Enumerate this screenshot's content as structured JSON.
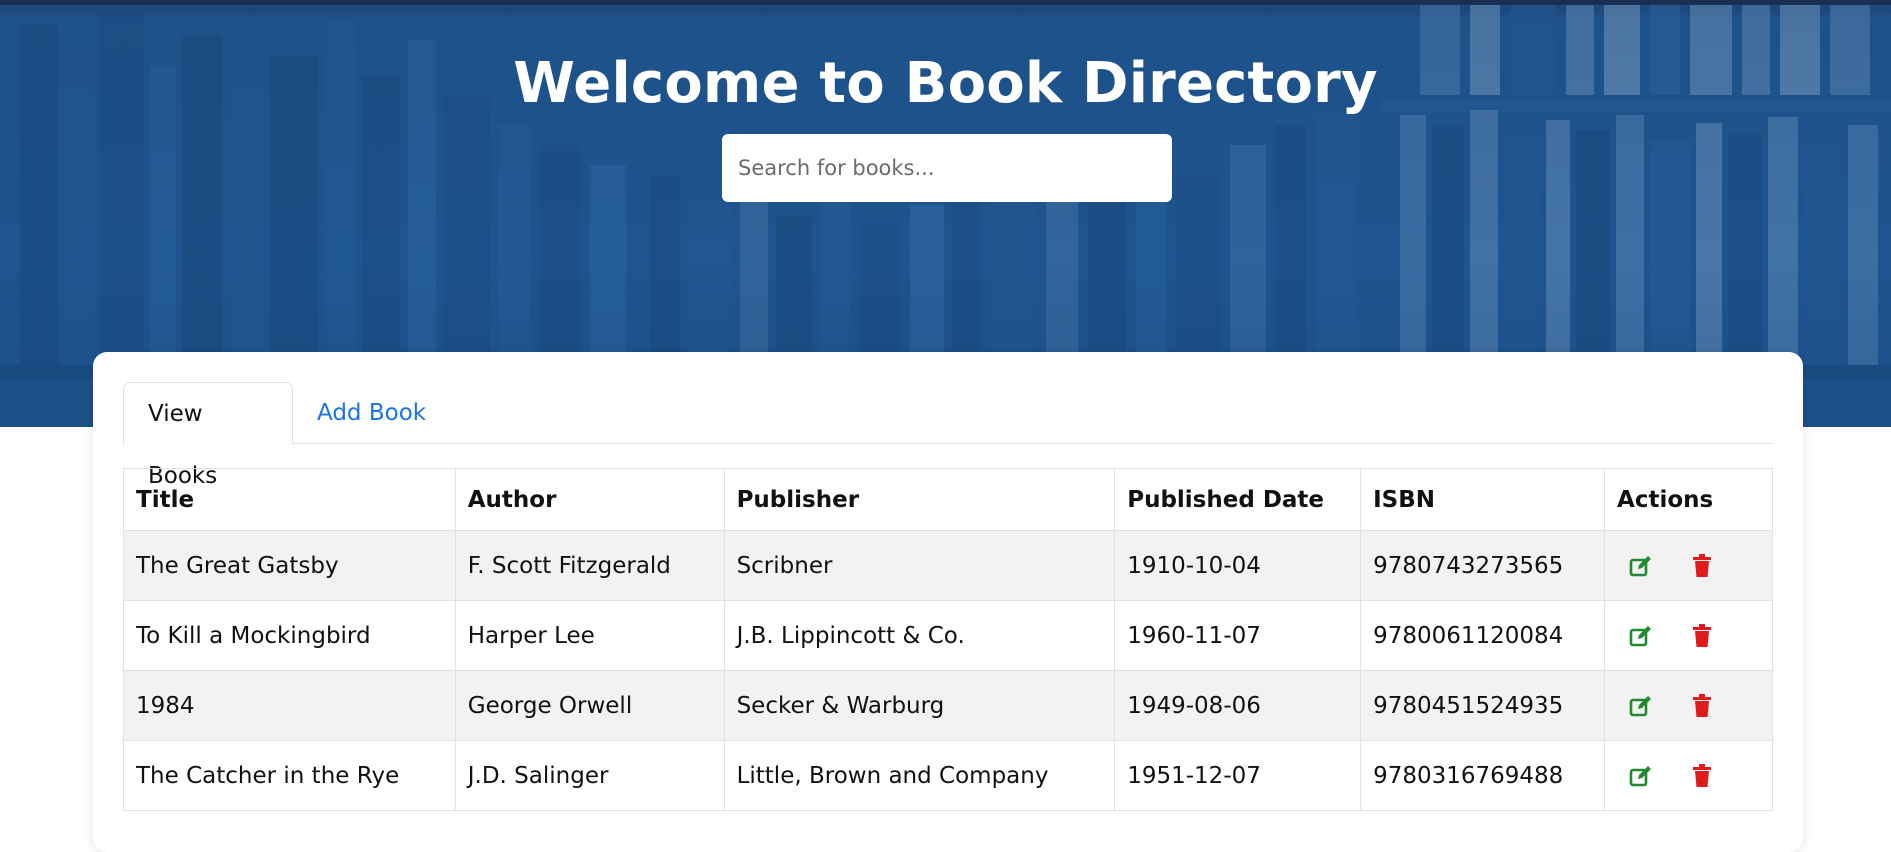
{
  "hero": {
    "title": "Welcome to Book Directory"
  },
  "search": {
    "placeholder": "Search for books..."
  },
  "tabs": [
    {
      "label": "View Books",
      "active": true
    },
    {
      "label": "Add Book",
      "active": false
    }
  ],
  "table": {
    "headers": [
      "Title",
      "Author",
      "Publisher",
      "Published Date",
      "ISBN",
      "Actions"
    ],
    "rows": [
      {
        "title": "The Great Gatsby",
        "author": "F. Scott Fitzgerald",
        "publisher": "Scribner",
        "published_date": "1910-10-04",
        "isbn": "9780743273565"
      },
      {
        "title": "To Kill a Mockingbird",
        "author": "Harper Lee",
        "publisher": "J.B. Lippincott & Co.",
        "published_date": "1960-11-07",
        "isbn": "9780061120084"
      },
      {
        "title": "1984",
        "author": "George Orwell",
        "publisher": "Secker & Warburg",
        "published_date": "1949-08-06",
        "isbn": "9780451524935"
      },
      {
        "title": "The Catcher in the Rye",
        "author": "J.D. Salinger",
        "publisher": "Little, Brown and Company",
        "published_date": "1951-12-07",
        "isbn": "9780316769488"
      }
    ]
  },
  "icons": {
    "edit": "edit-icon",
    "delete": "trash-icon"
  },
  "colors": {
    "hero_blue": "#1f5289",
    "link_blue": "#1a73e8",
    "edit_green": "#1f8a2e",
    "delete_red": "#e01b1b",
    "row_stripe": "#f2f2f2"
  }
}
